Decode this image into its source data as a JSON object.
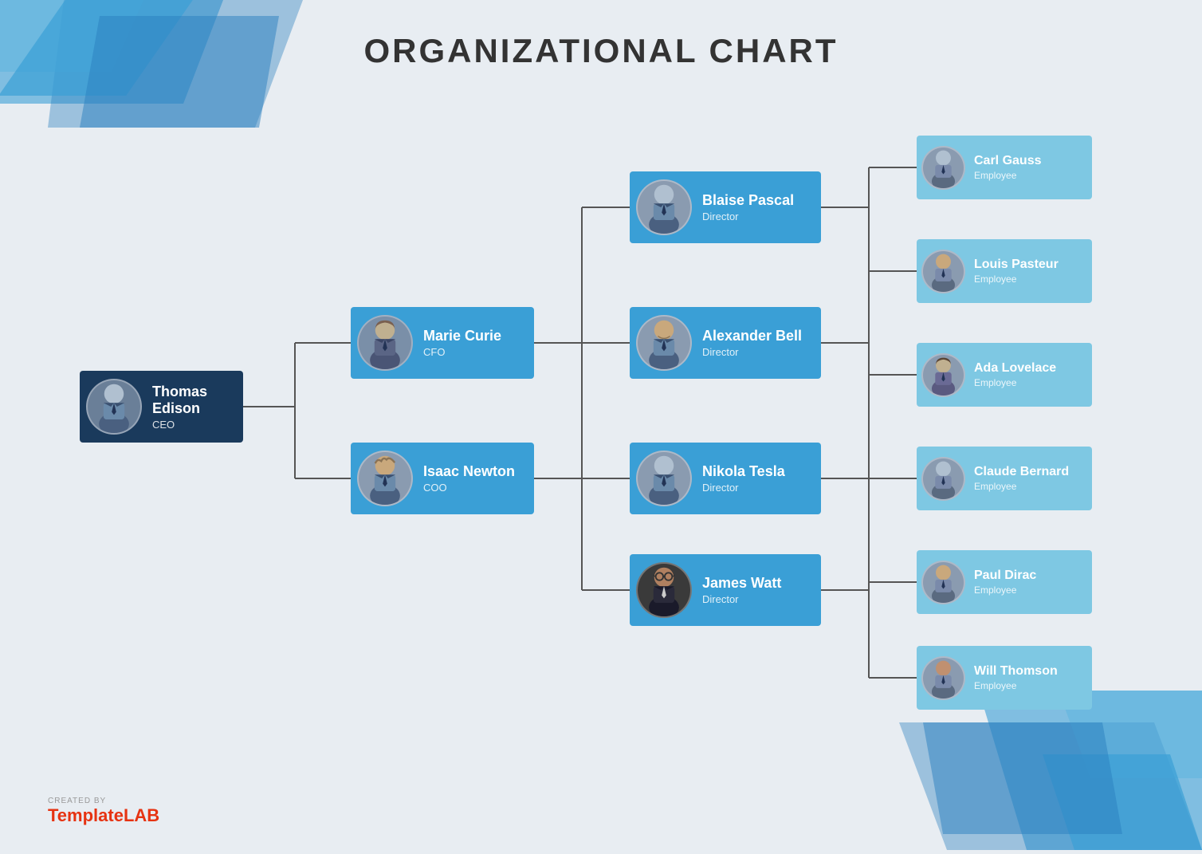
{
  "title": "ORGANIZATIONAL CHART",
  "watermark": {
    "created_by": "CREATED BY",
    "brand_part1": "Template",
    "brand_part2": "LAB"
  },
  "ceo": {
    "name": "Thomas Edison",
    "role": "CEO",
    "avatar_color": "#7a8fa8"
  },
  "vps": [
    {
      "name": "Marie Curie",
      "role": "CFO",
      "avatar_color": "#8a9bb0",
      "gender": "female"
    },
    {
      "name": "Isaac Newton",
      "role": "COO",
      "avatar_color": "#8a9bb0",
      "gender": "male"
    }
  ],
  "directors": [
    {
      "name": "Blaise Pascal",
      "role": "Director",
      "avatar_color": "#8a9bb0",
      "gender": "male"
    },
    {
      "name": "Alexander Bell",
      "role": "Director",
      "avatar_color": "#8a9bb0",
      "gender": "male"
    },
    {
      "name": "Nikola Tesla",
      "role": "Director",
      "avatar_color": "#8a9bb0",
      "gender": "male"
    },
    {
      "name": "James Watt",
      "role": "Director",
      "avatar_color": "#8a9bb0",
      "gender": "male_glasses"
    }
  ],
  "employees": [
    {
      "name": "Carl Gauss",
      "role": "Employee",
      "avatar_color": "#8a9bb0",
      "gender": "male"
    },
    {
      "name": "Louis Pasteur",
      "role": "Employee",
      "avatar_color": "#8a9bb0",
      "gender": "male"
    },
    {
      "name": "Ada Lovelace",
      "role": "Employee",
      "avatar_color": "#8a9bb0",
      "gender": "female"
    },
    {
      "name": "Claude Bernard",
      "role": "Employee",
      "avatar_color": "#8a9bb0",
      "gender": "male"
    },
    {
      "name": "Paul Dirac",
      "role": "Employee",
      "avatar_color": "#8a9bb0",
      "gender": "male"
    },
    {
      "name": "Will Thomson",
      "role": "Employee",
      "avatar_color": "#8a9bb0",
      "gender": "male"
    }
  ],
  "colors": {
    "ceo_bg": "#1a3a5c",
    "vp_bg": "#2a7dc4",
    "director_bg": "#3a9fd6",
    "employee_bg": "#7ec8e3",
    "line_color": "#555",
    "avatar_bg": "#8a9bb0"
  }
}
